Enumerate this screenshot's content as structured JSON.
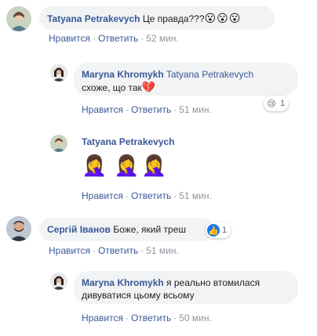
{
  "actions": {
    "like": "Нравится",
    "reply": "Ответить",
    "separator": "·"
  },
  "comments": [
    {
      "author": "Tatyana Petrakevych",
      "text": "Це правда???",
      "emoji": "😮😮😮",
      "time": "52 мин."
    },
    {
      "author": "Maryna Khromykh",
      "mention": "Tatyana Petrakevych",
      "text": "схоже, що так",
      "emoji": "💔",
      "time": "51 мин.",
      "reaction": {
        "icon": "😢",
        "count": "1"
      }
    },
    {
      "author": "Tatyana Petrakevych",
      "emoji": [
        "🤦‍♀️",
        "🤦‍♀️",
        "🤦‍♀️"
      ],
      "time": "51 мин."
    },
    {
      "author": "Сергій Іванов",
      "text": "Боже, який треш",
      "time": "51 мин.",
      "reaction": {
        "icon": "👍",
        "count": "1"
      }
    },
    {
      "author": "Maryna Khromykh",
      "text": "я реально втомилася дивуватися цьому всьому",
      "time": "50 мин."
    }
  ],
  "colors": {
    "link": "#385898",
    "bubble": "#f2f3f5",
    "meta": "#90949c",
    "like_blue": "#1877f2"
  }
}
